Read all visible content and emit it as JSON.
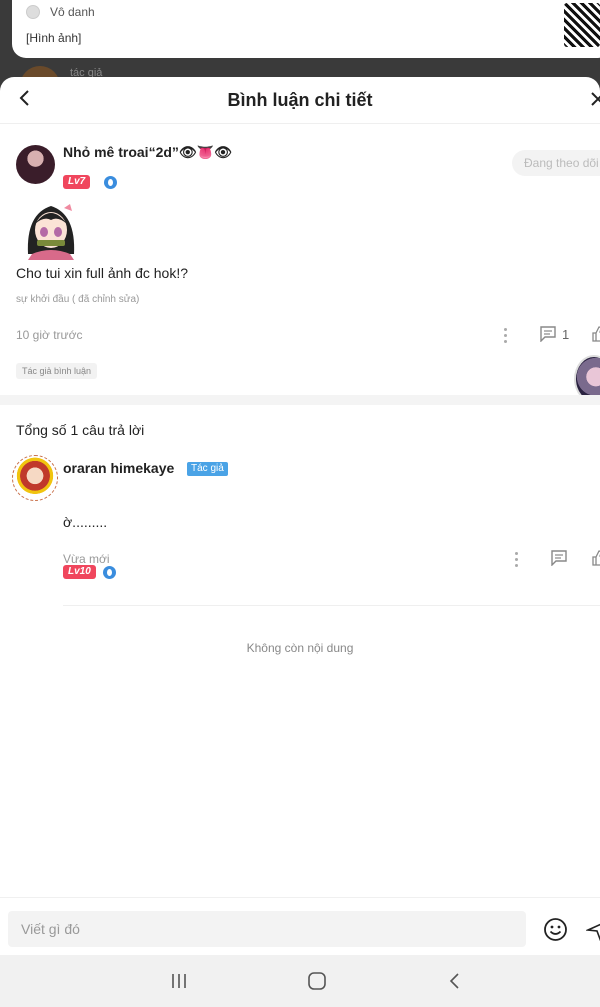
{
  "background": {
    "author_name": "Vô danh",
    "image_label": "[Hình ảnh]",
    "peek_label": "tác giả"
  },
  "header": {
    "title": "Bình luận chi tiết"
  },
  "main_comment": {
    "username": "Nhỏ mê troai“2d”👁👅👁",
    "level": "Lv7",
    "follow_label": "Đang theo dõi",
    "text": "Cho tui xin full ảnh đc hok!?",
    "edited_note": "sự khởi đầu ( đã chỉnh sửa)",
    "time": "10 giờ trước",
    "reply_count": "1",
    "tag": "Tác giả bình luận"
  },
  "replies": {
    "heading": "Tổng số 1 câu trả lời",
    "items": [
      {
        "username": "oraran himekaye",
        "author_tag": "Tác giả",
        "level": "Lv10",
        "text": "ờ.........",
        "time": "Vừa mới"
      }
    ]
  },
  "footer": {
    "no_more": "Không còn nội dung",
    "input_placeholder": "Viết gì đó"
  },
  "icons": {
    "back": "chevron-left-icon",
    "close": "close-icon",
    "more": "more-vertical-icon",
    "reply": "comment-icon",
    "like": "thumbs-up-icon",
    "emoji": "smiley-icon",
    "send": "send-icon"
  },
  "colors": {
    "level_badge": "#f0465d",
    "author_tag": "#4aa3e6",
    "verify": "#3a8dde"
  }
}
